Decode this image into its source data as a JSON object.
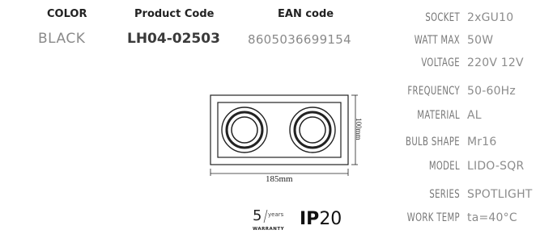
{
  "header": {
    "color_label": "COLOR",
    "code_label": "Product Code",
    "ean_label": "EAN code",
    "color_value": "BLACK",
    "code_value": "LH04-02503",
    "ean_value": "8605036699154"
  },
  "specs": [
    {
      "label": "SOCKET",
      "value": "2xGU10"
    },
    {
      "label": "WATT MAX",
      "value": "50W"
    },
    {
      "label": "VOLTAGE",
      "value": "220V 12V"
    },
    {
      "label": "FREQUENCY",
      "value": "50-60Hz"
    },
    {
      "label": "MATERIAL",
      "value": "AL"
    },
    {
      "label": "BULB SHAPE",
      "value": "Mr16"
    },
    {
      "label": "MODEL",
      "value": "LIDO-SQR"
    },
    {
      "label": "SERIES",
      "value": "SPOTLIGHT"
    },
    {
      "label": "WORK TEMP",
      "value": "ta=40°C"
    }
  ],
  "drawing": {
    "width_label": "185mm",
    "height_label": "100mm"
  },
  "badges": {
    "warranty_number": "5",
    "warranty_years": "years",
    "warranty_word": "WARRANTY",
    "ip_prefix": "IP",
    "ip_number": "20"
  }
}
